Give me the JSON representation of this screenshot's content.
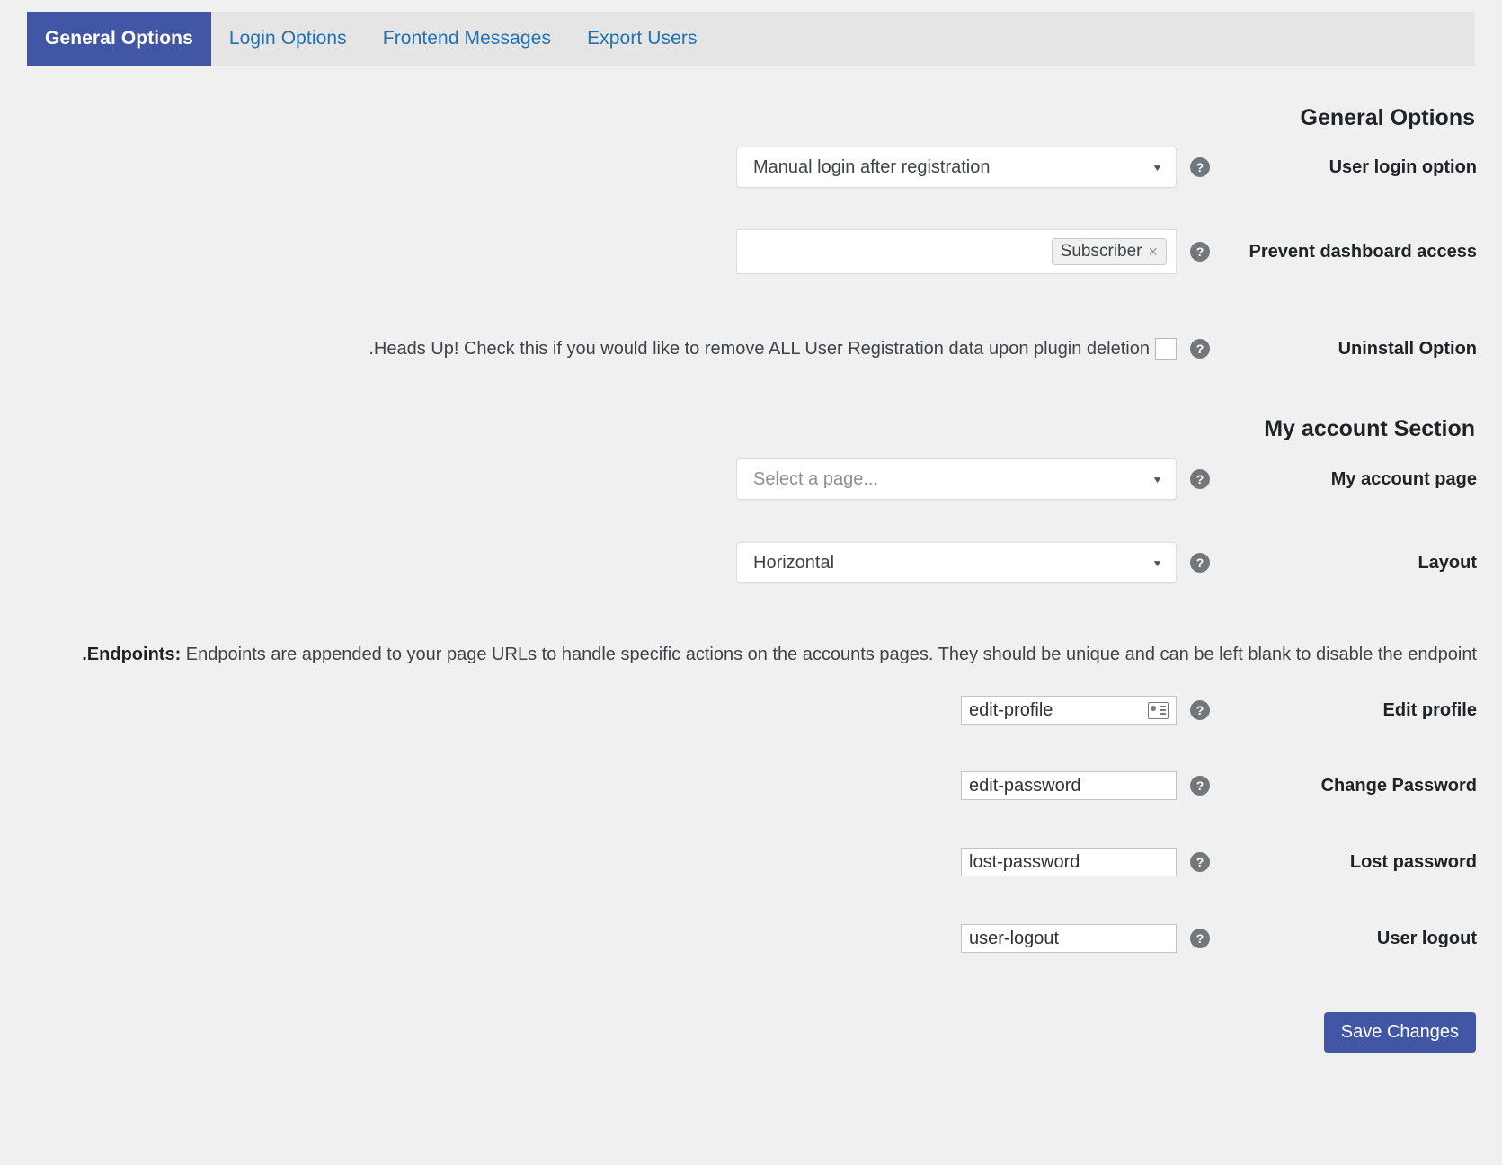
{
  "nav": {
    "tabs": [
      {
        "label": "Export Users",
        "active": false
      },
      {
        "label": "Frontend Messages",
        "active": false
      },
      {
        "label": "Login Options",
        "active": false
      },
      {
        "label": "General Options",
        "active": true
      }
    ]
  },
  "headings": {
    "general": "General Options",
    "my_account": "My account Section"
  },
  "icons": {
    "help": "?",
    "caret_down": "▼",
    "chip_close": "×"
  },
  "rows": {
    "user_login_option": {
      "label": "User login option",
      "value": "Manual login after registration"
    },
    "prevent_dashboard_access": {
      "label": "Prevent dashboard access",
      "chip": "Subscriber"
    },
    "uninstall_option": {
      "label": "Uninstall Option",
      "description": ".Heads Up! Check this if you would like to remove ALL User Registration data upon plugin deletion",
      "checked": false
    },
    "my_account_page": {
      "label": "My account page",
      "placeholder": "...Select a page"
    },
    "layout": {
      "label": "Layout",
      "value": "Horizontal"
    },
    "edit_profile": {
      "label": "Edit profile",
      "value": "edit-profile"
    },
    "change_password": {
      "label": "Change Password",
      "value": "edit-password"
    },
    "lost_password": {
      "label": "Lost password",
      "value": "lost-password"
    },
    "user_logout": {
      "label": "User logout",
      "value": "user-logout"
    }
  },
  "endpoints_note": {
    "prefix": ".Endpoints:",
    "text": " Endpoints are appended to your page URLs to handle specific actions on the accounts pages. They should be unique and can be left blank to disable the endpoint"
  },
  "footer": {
    "save_label": "Save Changes"
  },
  "colors": {
    "accent": "#4256a6",
    "link": "#2271b1",
    "page_bg": "#f0f0f1",
    "navbar_bg": "#e5e5e5"
  }
}
